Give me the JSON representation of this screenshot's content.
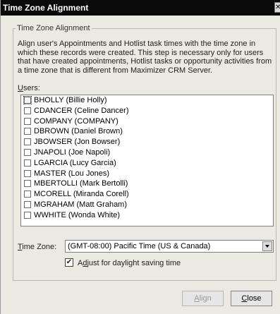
{
  "window": {
    "title": "Time Zone Alignment"
  },
  "group": {
    "legend": "Time Zone Alignment",
    "description": "Align user's Appointments and Hotlist task times with the time zone in which these records were created. This step is necessary only for users that have created appointments, Hotlist tasks or opportunity activities from a time zone that is different from Maximizer CRM Server."
  },
  "users": {
    "label_underlined": "U",
    "label_rest": "sers:",
    "items": [
      {
        "label": "BHOLLY (Billie Holly)",
        "checked": false
      },
      {
        "label": "CDANCER (Celine Dancer)",
        "checked": false
      },
      {
        "label": "COMPANY (COMPANY)",
        "checked": false
      },
      {
        "label": "DBROWN (Daniel Brown)",
        "checked": false
      },
      {
        "label": "JBOWSER (Jon Bowser)",
        "checked": false
      },
      {
        "label": "JNAPOLI (Joe Napoli)",
        "checked": false
      },
      {
        "label": "LGARCIA (Lucy Garcia)",
        "checked": false
      },
      {
        "label": "MASTER (Lou Jones)",
        "checked": false
      },
      {
        "label": "MBERTOLLI (Mark Bertolli)",
        "checked": false
      },
      {
        "label": "MCORELL (Miranda Corell)",
        "checked": false
      },
      {
        "label": "MGRAHAM (Matt Graham)",
        "checked": false
      },
      {
        "label": "WWHITE (Wonda White)",
        "checked": false
      }
    ]
  },
  "timezone": {
    "label_underlined": "T",
    "label_rest": "ime Zone:",
    "value": "(GMT-08:00) Pacific Time (US & Canada)"
  },
  "dst": {
    "checked": true,
    "label_pre": "A",
    "label_underlined": "d",
    "label_rest": "just for daylight saving time"
  },
  "buttons": {
    "align": {
      "underlined": "A",
      "rest": "lign",
      "enabled": false
    },
    "close": {
      "underlined": "C",
      "rest": "lose",
      "enabled": true
    }
  }
}
